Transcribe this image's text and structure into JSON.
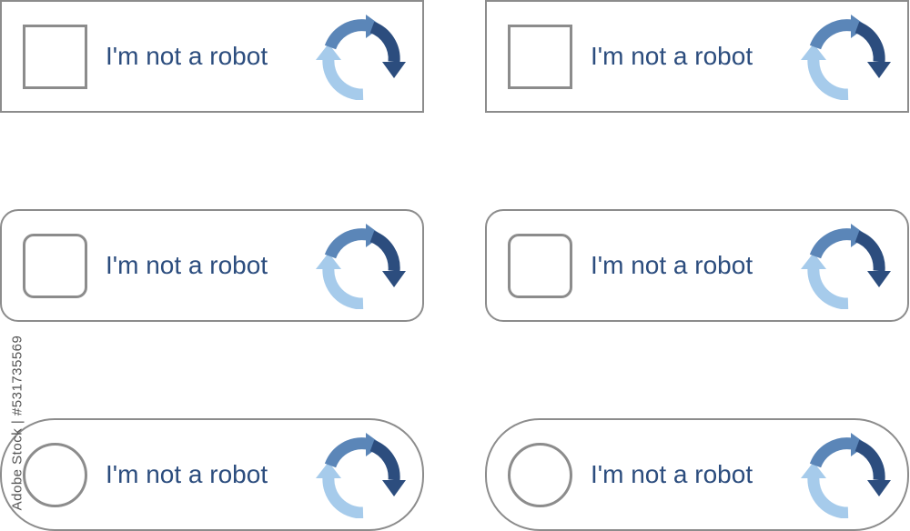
{
  "widgets": [
    {
      "label": "I'm not a robot",
      "shape": "square"
    },
    {
      "label": "I'm not a robot",
      "shape": "square"
    },
    {
      "label": "I'm not a robot",
      "shape": "rounded"
    },
    {
      "label": "I'm not a robot",
      "shape": "rounded"
    },
    {
      "label": "I'm not a robot",
      "shape": "pill"
    },
    {
      "label": "I'm not a robot",
      "shape": "pill"
    }
  ],
  "logo": {
    "icon": "refresh-arrows-icon",
    "colors": {
      "dark": "#2c4d7e",
      "mid": "#5b86b8",
      "light": "#a6cbeb"
    }
  },
  "watermark": {
    "text": "Adobe Stock | #531735569"
  },
  "colors": {
    "border": "#8c8c8c",
    "text": "#2c4d7e",
    "background": "#ffffff"
  }
}
